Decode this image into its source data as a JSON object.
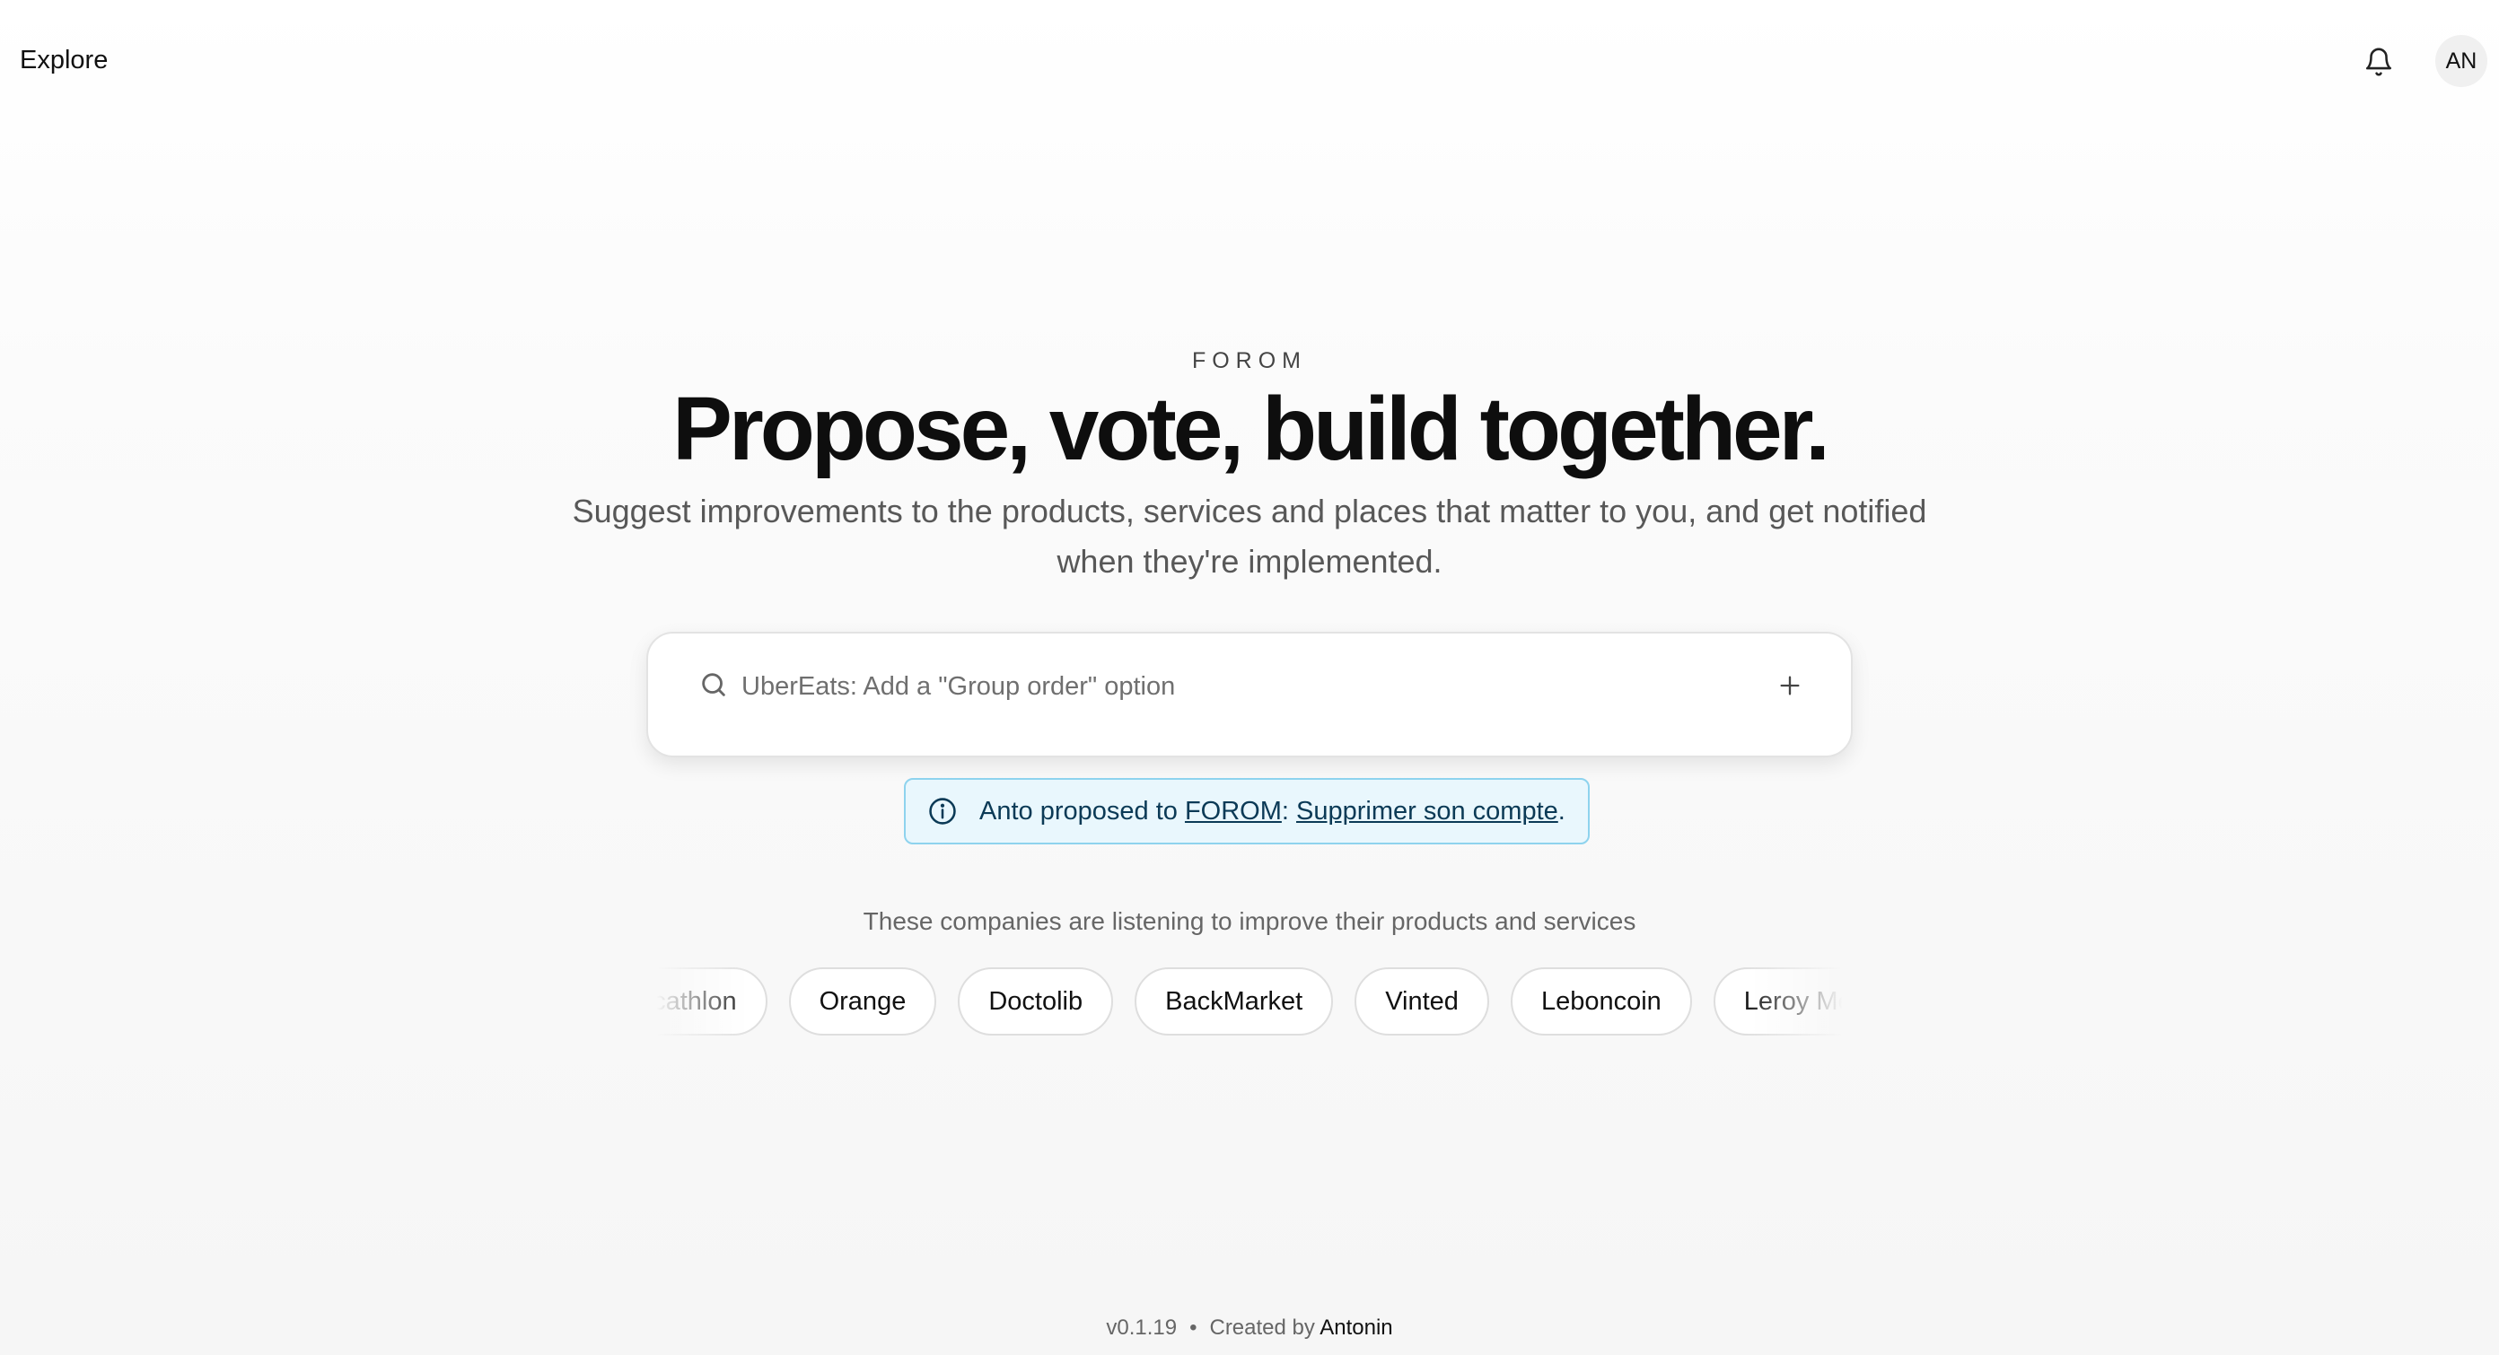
{
  "header": {
    "explore_label": "Explore",
    "bell_icon": "bell-icon",
    "avatar_initials": "AN"
  },
  "hero": {
    "eyebrow": "FOROM",
    "headline": "Propose, vote, build together.",
    "subtitle": "Suggest improvements to the products, services and places that matter to you, and get notified when they're implemented."
  },
  "search": {
    "placeholder": "UberEats: Add a \"Group order\" option",
    "value": "",
    "search_icon": "search-icon",
    "add_icon": "plus-icon"
  },
  "notice": {
    "icon": "info-icon",
    "prefix": "Anto proposed to ",
    "target_link": "FOROM",
    "separator": ": ",
    "proposal_link": "Supprimer son compte",
    "suffix": ".",
    "colors": {
      "background": "#e9f7fd",
      "border": "#8ed3ee",
      "text": "#0b3a56"
    }
  },
  "companies": {
    "caption": "These companies are listening to improve their products and services",
    "items": [
      "Decathlon",
      "Orange",
      "Doctolib",
      "BackMarket",
      "Vinted",
      "Leboncoin",
      "Leroy Merlin"
    ]
  },
  "footer": {
    "version": "v0.1.19",
    "separator": "•",
    "created_by_label": "Created by",
    "author": "Antonin"
  }
}
